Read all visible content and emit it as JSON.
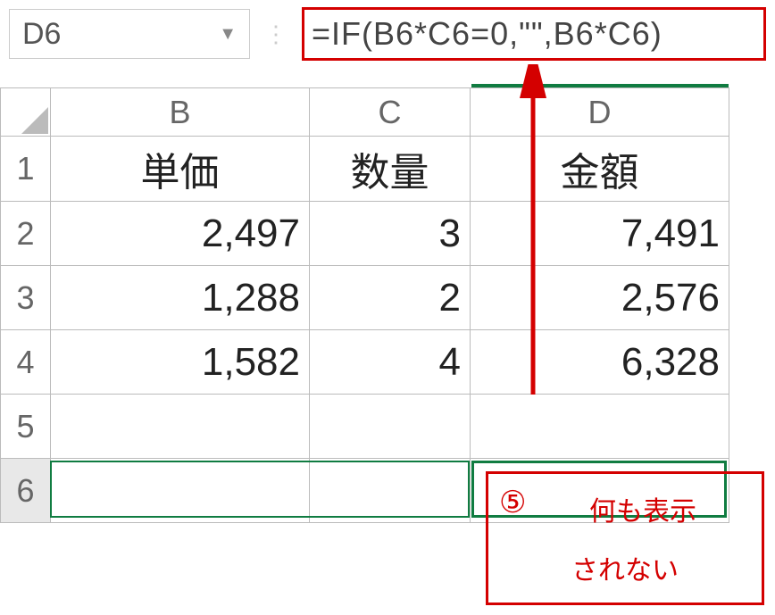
{
  "name_box": {
    "value": "D6"
  },
  "formula_bar": {
    "value": "=IF(B6*C6=0,\"\",B6*C6)"
  },
  "columns": {
    "b": "B",
    "c": "C",
    "d": "D"
  },
  "rows": {
    "r1": "1",
    "r2": "2",
    "r3": "3",
    "r4": "4",
    "r5": "5",
    "r6": "6"
  },
  "headers": {
    "b": "単価",
    "c": "数量",
    "d": "金額"
  },
  "data": {
    "r2": {
      "b": "2,497",
      "c": "3",
      "d": "7,491"
    },
    "r3": {
      "b": "1,288",
      "c": "2",
      "d": "2,576"
    },
    "r4": {
      "b": "1,582",
      "c": "4",
      "d": "6,328"
    },
    "r5": {
      "b": "",
      "c": "",
      "d": ""
    },
    "r6": {
      "b": "",
      "c": "",
      "d": ""
    }
  },
  "annotation": {
    "num": "⑤",
    "line1": "何も表示",
    "line2": "されない"
  }
}
